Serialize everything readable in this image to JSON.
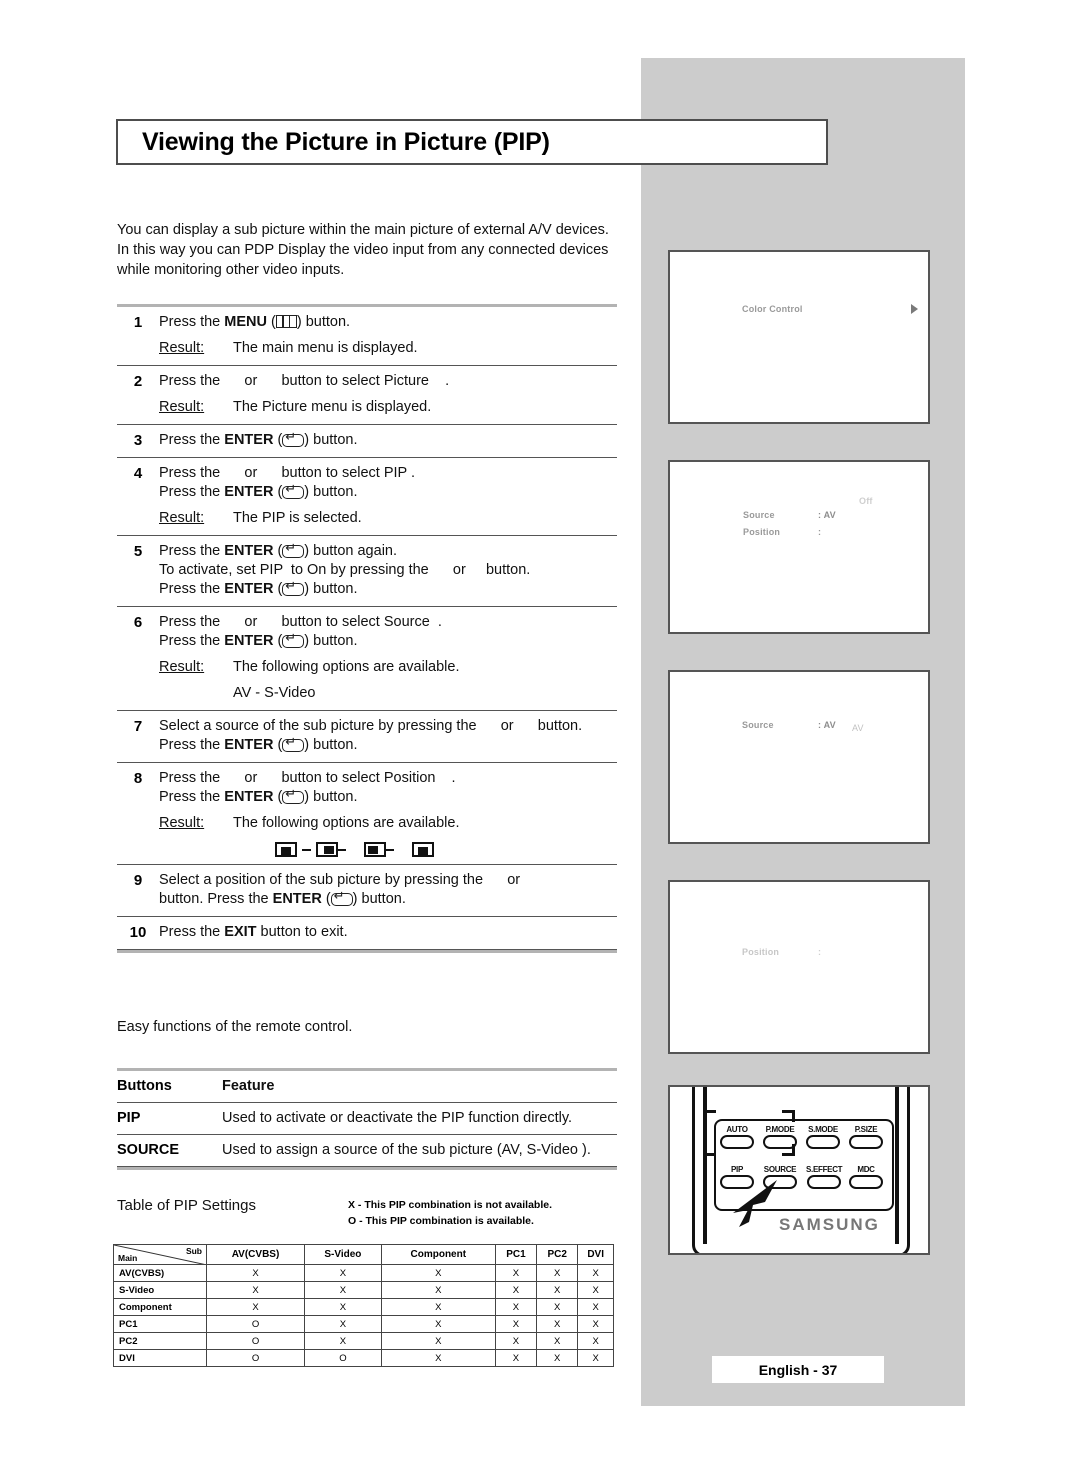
{
  "title": "Viewing the Picture in Picture (PIP)",
  "intro": "You can display a sub picture within the main picture of external A/V devices. In this way you can PDP Display the video input from any connected devices while monitoring other video inputs.",
  "steps": [
    {
      "num": "1",
      "lines": [
        {
          "pre": "Press the ",
          "bold": "MENU",
          "icon": "menu-icon",
          "post": ") button."
        }
      ],
      "result_label": "Result:",
      "result": "The main menu is displayed."
    },
    {
      "num": "2",
      "lines": [
        {
          "pre": "Press the      or      button to select Picture    ."
        }
      ],
      "result_label": "Result:",
      "result": "The Picture      menu is displayed."
    },
    {
      "num": "3",
      "lines": [
        {
          "pre": "Press the ",
          "bold": "ENTER",
          "icon": "enter-icon",
          "post": ") button."
        }
      ]
    },
    {
      "num": "4",
      "lines": [
        {
          "pre": "Press the      or      button to select PIP ."
        },
        {
          "pre": "Press the ",
          "bold": "ENTER",
          "icon": "enter-icon",
          "post": ") button."
        }
      ],
      "result_label": "Result:",
      "result": "The PIP  is selected."
    },
    {
      "num": "5",
      "lines": [
        {
          "pre": "Press the ",
          "bold": "ENTER",
          "icon": "enter-icon",
          "post": ") button again."
        },
        {
          "pre": "To activate, set PIP  to On by pressing the      or     button."
        },
        {
          "pre": "Press the ",
          "bold": "ENTER",
          "icon": "enter-icon",
          "post": ") button."
        }
      ]
    },
    {
      "num": "6",
      "lines": [
        {
          "pre": "Press the      or      button to select Source  ."
        },
        {
          "pre": "Press the ",
          "bold": "ENTER",
          "icon": "enter-icon",
          "post": ") button."
        }
      ],
      "result_label": "Result:",
      "result": "The following options are available.",
      "option_line": "AV - S-Video"
    },
    {
      "num": "7",
      "lines": [
        {
          "pre": "Select a source of the sub picture by pressing the      or      button."
        },
        {
          "pre": "Press the ",
          "bold": "ENTER",
          "icon": "enter-icon",
          "post": ") button."
        }
      ]
    },
    {
      "num": "8",
      "lines": [
        {
          "pre": "Press the      or      button to select Position    ."
        },
        {
          "pre": "Press the ",
          "bold": "ENTER",
          "icon": "enter-icon",
          "post": ") button."
        }
      ],
      "result_label": "Result:",
      "result": "The following options are available.",
      "position_icons": true
    },
    {
      "num": "9",
      "lines": [
        {
          "pre": "Select a position of the sub picture by pressing the      or"
        },
        {
          "pre": "button. Press the ",
          "bold": "ENTER",
          "icon": "enter-icon",
          "post": ") button."
        }
      ]
    },
    {
      "num": "10",
      "lines": [
        {
          "pre": "Press the ",
          "bold": "EXIT",
          "post": " button to exit."
        }
      ]
    }
  ],
  "easy_functions": "Easy functions of the remote control.",
  "buttons_table": {
    "headers": [
      "Buttons",
      "Feature"
    ],
    "rows": [
      {
        "button": "PIP",
        "feature": "Used to activate or deactivate the PIP function directly."
      },
      {
        "button": "SOURCE",
        "feature": "Used to assign a source of the sub picture (AV, S-Video  )."
      }
    ]
  },
  "pip_table_heading": "Table of PIP Settings",
  "pip_legend": [
    "X - This PIP combination is not available.",
    "O - This PIP combination is available."
  ],
  "matrix": {
    "corner_main": "Main",
    "corner_sub": "Sub",
    "columns": [
      "AV(CVBS)",
      "S-Video",
      "Component",
      "PC1",
      "PC2",
      "DVI"
    ],
    "rows": [
      {
        "label": "AV(CVBS)",
        "values": [
          "X",
          "X",
          "X",
          "X",
          "X",
          "X"
        ]
      },
      {
        "label": "S-Video",
        "values": [
          "X",
          "X",
          "X",
          "X",
          "X",
          "X"
        ]
      },
      {
        "label": "Component",
        "values": [
          "X",
          "X",
          "X",
          "X",
          "X",
          "X"
        ]
      },
      {
        "label": "PC1",
        "values": [
          "O",
          "X",
          "X",
          "X",
          "X",
          "X"
        ]
      },
      {
        "label": "PC2",
        "values": [
          "O",
          "X",
          "X",
          "X",
          "X",
          "X"
        ]
      },
      {
        "label": "DVI",
        "values": [
          "O",
          "O",
          "X",
          "X",
          "X",
          "X"
        ]
      }
    ]
  },
  "osd_screens": [
    {
      "name": "color-control",
      "rows": [
        {
          "label": "Color Control",
          "value": ""
        }
      ],
      "arrow": true
    },
    {
      "name": "pip-menu",
      "rows": [
        {
          "label": "",
          "value": "Off"
        },
        {
          "label": "Source",
          "value": ": AV"
        },
        {
          "label": "Position",
          "value": ":"
        }
      ]
    },
    {
      "name": "pip-source",
      "rows": [
        {
          "label": "Source",
          "value": ": AV",
          "extra": "AV"
        }
      ]
    },
    {
      "name": "pip-position",
      "rows": [
        {
          "label": "Position",
          "value": ":"
        }
      ]
    }
  ],
  "remote": {
    "brand": "SAMSUNG",
    "buttons_row1": [
      "AUTO",
      "P.MODE",
      "S.MODE",
      "P.SIZE"
    ],
    "buttons_row2": [
      "PIP",
      "SOURCE",
      "S.EFFECT",
      "MDC"
    ]
  },
  "footer": "English - 37"
}
